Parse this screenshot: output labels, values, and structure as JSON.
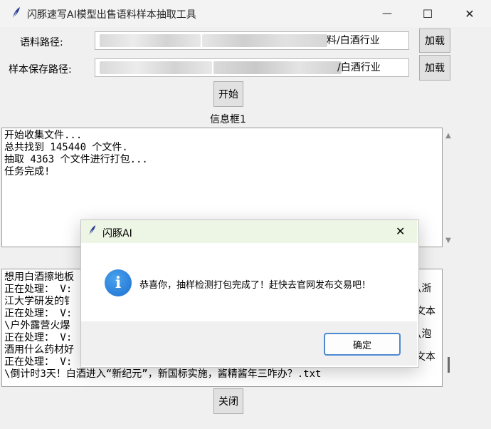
{
  "window": {
    "title": "闪豚速写AI模型出售语料样本抽取工具",
    "controls": {
      "minimize": "—",
      "maximize": "☐",
      "close": "✕"
    }
  },
  "form": {
    "corpus_label": "语料路径:",
    "corpus_value_visible": "料/白酒行业",
    "sample_label": "样本保存路径:",
    "sample_value_visible": "/白酒行业",
    "load_button": "加载",
    "load_button_2": "加载",
    "start_button": "开始"
  },
  "info_box": {
    "label": "信息框1",
    "lines": [
      "开始收集文件...",
      "总共找到 145440 个文件.",
      "抽取 4363 个文件进行打包...",
      "任务完成!"
    ]
  },
  "log_box": {
    "lines": [
      "想用白酒擦地板",
      "正在处理： V:",
      "江大学研发的钅",
      "正在处理： V:",
      "\\户外露营火爆",
      "正在处理： V:",
      "酒用什么药材好",
      "正在处理： V:",
      "\\倒计时3天！白酒进入“新纪元”，新国标实施，酱精酱年三咋办？.txt"
    ],
    "right_fragments": [
      "\\浙",
      "文本",
      "\\泡",
      "文本"
    ]
  },
  "close_button": "关闭",
  "dialog": {
    "title": "闪豚AI",
    "message": "恭喜你，抽样检测打包完成了！赶快去官网发布交易吧！",
    "ok_button": "确定",
    "close_glyph": "✕",
    "info_glyph": "i"
  },
  "colors": {
    "dialog_title_bg": "#edf5e5",
    "info_blue": "#1c6fcf",
    "ok_border": "#4e8ad1"
  }
}
